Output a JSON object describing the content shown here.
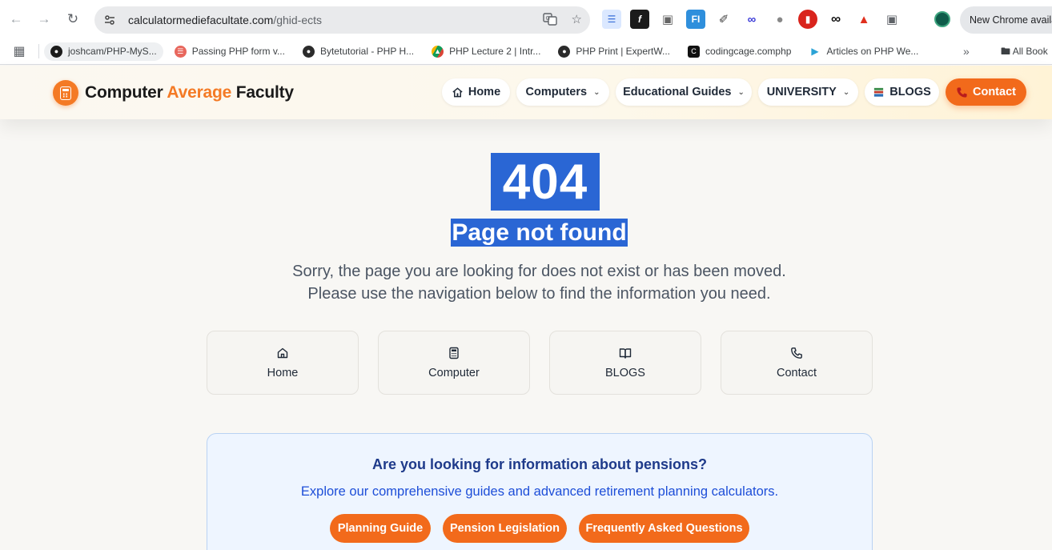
{
  "browser": {
    "url_domain": "calculatormediefacultate.com",
    "url_path": "/ghid-ects",
    "update_chip": "New Chrome availa",
    "bookmarks": [
      {
        "label": "joshcam/PHP-MyS..."
      },
      {
        "label": "Passing PHP form v..."
      },
      {
        "label": "Bytetutorial - PHP H..."
      },
      {
        "label": "PHP Lecture 2 | Intr..."
      },
      {
        "label": "PHP Print | ExpertW..."
      },
      {
        "label": "codingcage.comphp"
      },
      {
        "label": "Articles on PHP We..."
      }
    ],
    "all_bookmarks_label": "All Book"
  },
  "site": {
    "brand_part1": "Computer ",
    "brand_accent": "Average",
    "brand_part2": " Faculty",
    "brand_accent_color": "#f47a25",
    "nav": [
      {
        "label": "Home",
        "icon": "home-icon"
      },
      {
        "label": "Computers",
        "dropdown": true
      },
      {
        "label": "Educational Guides",
        "dropdown": true
      },
      {
        "label": "UNIVERSITY",
        "dropdown": true
      },
      {
        "label": "BLOGS",
        "icon": "books-icon"
      },
      {
        "label": "Contact",
        "icon": "phone-icon"
      }
    ]
  },
  "error": {
    "code": "404",
    "title": "Page not found",
    "message_line1": "Sorry, the page you are looking for does not exist or has been moved.",
    "message_line2": "Please use the navigation below to find the information you need.",
    "selection_color": "#2a66d4"
  },
  "quick_links": [
    {
      "label": "Home",
      "icon": "home-icon"
    },
    {
      "label": "Computer",
      "icon": "calculator-icon"
    },
    {
      "label": "BLOGS",
      "icon": "book-open-icon"
    },
    {
      "label": "Contact",
      "icon": "phone-icon"
    }
  ],
  "pension": {
    "title": "Are you looking for information about pensions?",
    "subtitle": "Explore our comprehensive guides and advanced retirement planning calculators.",
    "buttons": [
      {
        "label": "Planning Guide"
      },
      {
        "label": "Pension Legislation"
      },
      {
        "label": "Frequently Asked Questions"
      }
    ],
    "button_color": "#f26a1b"
  }
}
